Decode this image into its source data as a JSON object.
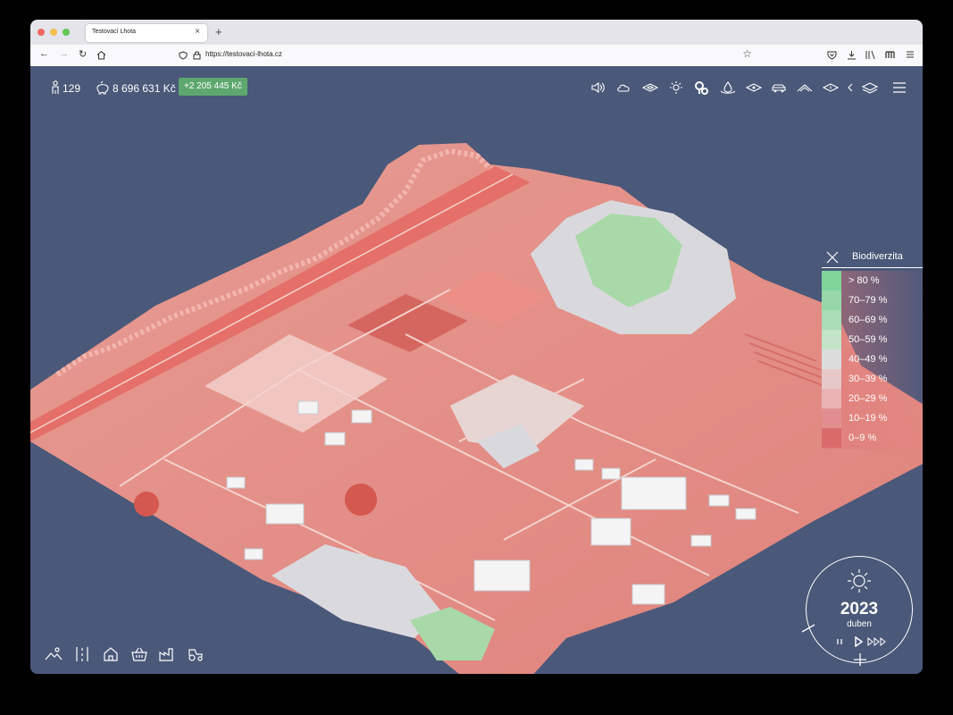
{
  "browser": {
    "tab_title": "Testovací Lhota",
    "tab_close": "×",
    "new_tab": "+",
    "url": "https://testovaci-lhota.cz",
    "traffic_colors": [
      "#ed6a5e",
      "#f5bf4f",
      "#61c554"
    ]
  },
  "app": {
    "population": "129",
    "money": "8 696 631 Kč",
    "money_delta": "+2 205 445 Kč",
    "legend": {
      "title": "Biodiverzita",
      "items": [
        {
          "label": "> 80 %",
          "color": "#7fd49a"
        },
        {
          "label": "70–79 %",
          "color": "#96d8a8"
        },
        {
          "label": "60–69 %",
          "color": "#aadcb6"
        },
        {
          "label": "50–59 %",
          "color": "#c3e4c8"
        },
        {
          "label": "40–49 %",
          "color": "#dcdcdc"
        },
        {
          "label": "30–39 %",
          "color": "#e6c8c8"
        },
        {
          "label": "20–29 %",
          "color": "#e9b3b3"
        },
        {
          "label": "10–19 %",
          "color": "#e28e8e"
        },
        {
          "label": "0–9 %",
          "color": "#d96a6a"
        }
      ]
    },
    "date": {
      "year": "2023",
      "month": "duben"
    },
    "colors": {
      "background": "#4a5879",
      "accent_green": "#5ea870",
      "terrain_red": "#e08a84"
    }
  }
}
